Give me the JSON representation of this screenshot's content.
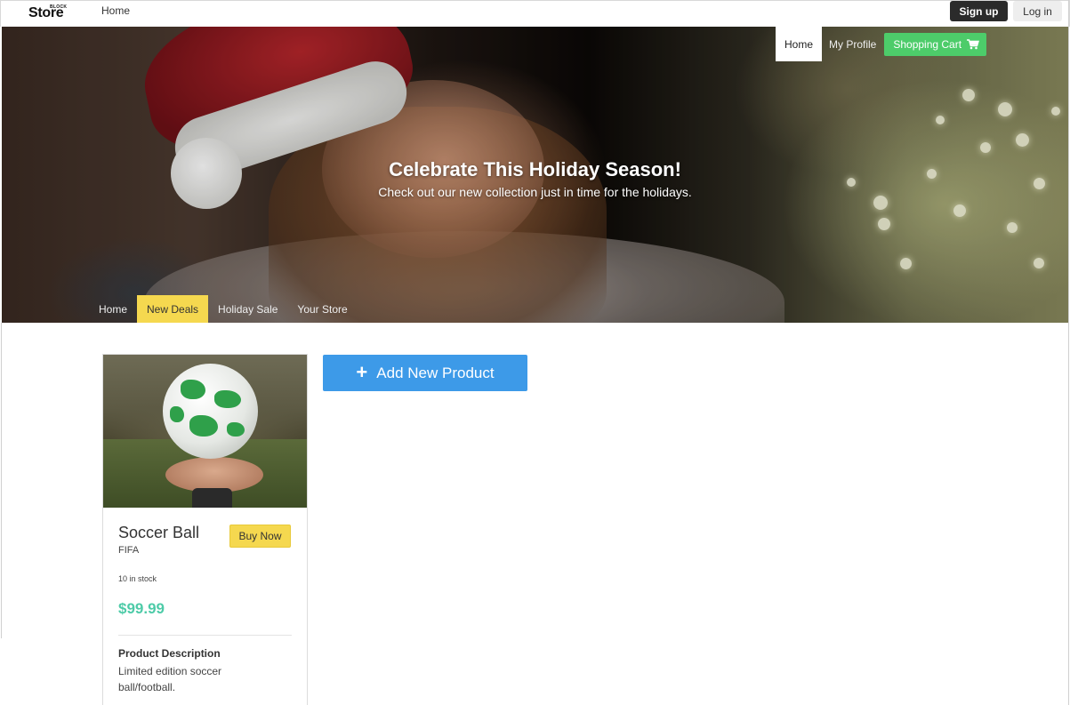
{
  "topbar": {
    "logo_small": "BLOCK",
    "logo_main": "Store",
    "home_link": "Home",
    "signup_label": "Sign up",
    "login_label": "Log in"
  },
  "hero": {
    "title": "Celebrate This Holiday Season!",
    "subtitle": "Check out our new collection just in time for the holidays.",
    "nav": {
      "home": "Home",
      "profile": "My Profile",
      "cart": "Shopping Cart",
      "cart_icon": "shopping-cart-icon"
    },
    "subnav": [
      {
        "label": "Home",
        "active": false
      },
      {
        "label": "New Deals",
        "active": true
      },
      {
        "label": "Holiday Sale",
        "active": false
      },
      {
        "label": "Your Store",
        "active": false
      }
    ]
  },
  "product": {
    "name": "Soccer Ball",
    "brand": "FIFA",
    "buy_label": "Buy Now",
    "stock": "10 in stock",
    "price": "$99.99",
    "description_label": "Product Description",
    "description": "Limited edition soccer ball/football."
  },
  "actions": {
    "add_product_label": "Add New Product",
    "add_icon": "plus-icon"
  },
  "colors": {
    "accent_yellow": "#f5d84f",
    "cart_green": "#4dcc6a",
    "add_blue": "#3d9ae8",
    "price_teal": "#4ecba8"
  }
}
